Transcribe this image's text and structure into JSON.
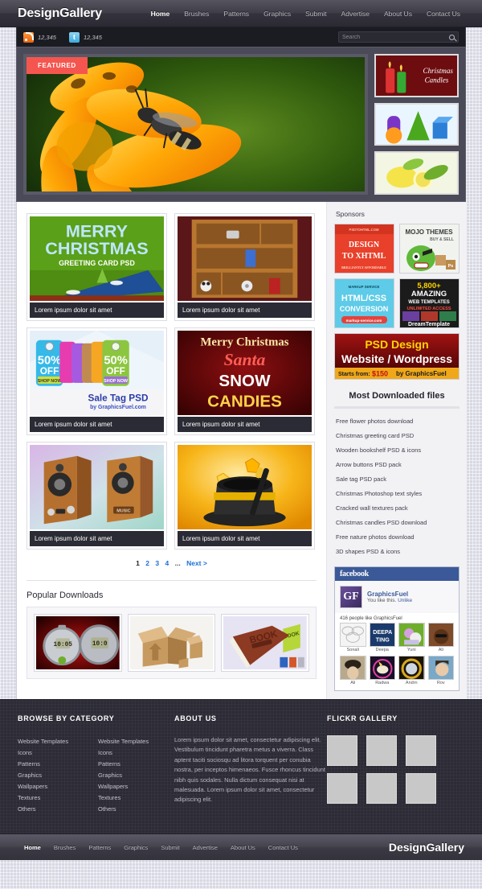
{
  "site": {
    "brand": "DesignGallery",
    "footer_brand": "DesignGallery"
  },
  "topnav": {
    "items": [
      {
        "label": "Home",
        "active": true
      },
      {
        "label": "Brushes",
        "active": false
      },
      {
        "label": "Patterns",
        "active": false
      },
      {
        "label": "Graphics",
        "active": false
      },
      {
        "label": "Submit",
        "active": false
      },
      {
        "label": "Advertise",
        "active": false
      },
      {
        "label": "About Us",
        "active": false
      },
      {
        "label": "Contact Us",
        "active": false
      }
    ]
  },
  "utilbar": {
    "rss_icon": "rss-icon",
    "rss_count": "12,345",
    "twitter_icon": "twitter-icon",
    "twitter_count": "12,345",
    "search_placeholder": "Search",
    "search_value": "",
    "search_icon": "magnifier-icon"
  },
  "slider": {
    "badge": "FEATURED",
    "main_alt": "bee-on-orange-flower",
    "thumbs": [
      {
        "alt": "christmas-candles",
        "caption": "Christmas Candles"
      },
      {
        "alt": "3d-shapes"
      },
      {
        "alt": "lemons"
      }
    ]
  },
  "gallery": {
    "cards": [
      {
        "alt": "merry-christmas-greeting-card",
        "title_line1": "MERRY",
        "title_line2": "CHRISTMAS",
        "subtitle": "GREETING CARD PSD",
        "caption": "Lorem ipsum dolor sit amet"
      },
      {
        "alt": "wooden-bookshelf",
        "caption": "Lorem ipsum dolor sit amet"
      },
      {
        "alt": "sale-tag-psd",
        "label": "50%",
        "label2": "OFF",
        "button": "SHOP NOW",
        "title": "Sale Tag PSD",
        "byline": "by GraphicsFuel.com",
        "caption": "Lorem ipsum dolor sit amet"
      },
      {
        "alt": "santa-snow-candies",
        "line1": "Merry Christmas",
        "line2": "Santa",
        "line3": "SNOW",
        "line4": "CANDIES",
        "caption": "Lorem ipsum dolor sit amet"
      },
      {
        "alt": "wooden-speakers",
        "badge": "MUSIC",
        "caption": "Lorem ipsum dolor sit amet"
      },
      {
        "alt": "magic-hat-and-wand",
        "caption": "Lorem ipsum dolor sit amet"
      }
    ],
    "pagination": {
      "pages": [
        "1",
        "2",
        "3",
        "4"
      ],
      "current": "1",
      "ellipsis": "...",
      "next": "Next >"
    }
  },
  "popular": {
    "heading": "Popular Downloads",
    "items": [
      {
        "alt": "stopwatch-icons",
        "display": "10:05"
      },
      {
        "alt": "cardboard-box-icons"
      },
      {
        "alt": "book-icons",
        "display": "BOOK"
      }
    ]
  },
  "sidebar": {
    "sponsors_title": "Sponsors",
    "ads": [
      {
        "name": "design-to-xhtml-ad",
        "top": "PSDTOHTML.COM",
        "line1": "DESIGN",
        "line2": "TO XHTML",
        "foot": "BRILLIANTLY AFFORDABLE"
      },
      {
        "name": "mojo-themes-ad",
        "line1": "MOJO THEMES",
        "line2": "BUY & SELL"
      },
      {
        "name": "markup-service-ad",
        "top": "MARKUP SERVICE",
        "line1": "HTML/CSS",
        "line2": "CONVERSION",
        "foot": "markup-service.com"
      },
      {
        "name": "dreamtemplate-ad",
        "line1": "5,800+",
        "line2": "AMAZING",
        "line3": "WEB TEMPLATES",
        "line4": "UNLIMITED ACCESS",
        "foot": "DreamTemplate"
      }
    ],
    "wide_ad": {
      "name": "psd-design-ad",
      "line1": "PSD Design",
      "line2": "Website / Wordpress",
      "foot_left": "Starts from:",
      "foot_price": "$150",
      "foot_right": "by GraphicsFuel"
    },
    "most_downloaded_title": "Most Downloaded files",
    "most_downloaded": [
      "Free flower photos download",
      "Christmas greeting card PSD",
      "Wooden bookshelf PSD & icons",
      "Arrow buttons PSD pack",
      "Sale tag PSD pack",
      "Christmas Photoshop text styles",
      "Cracked wall textures pack",
      "Christmas candles PSD download",
      "Free nature photos download",
      "3D shapes PSD & icons"
    ],
    "facebook": {
      "bar_title": "facebook",
      "avatar_text": "GF",
      "page_name": "GraphicsFuel",
      "like_status": "You like this.",
      "unlike": "Unlike",
      "count_text": "416 people like GraphicsFuel",
      "fans": [
        {
          "name": "Sonali"
        },
        {
          "name": "Deepa"
        },
        {
          "name": "Yuni"
        },
        {
          "name": "Ali"
        },
        {
          "name": "Ali"
        },
        {
          "name": "Radwa"
        },
        {
          "name": "Andrn"
        },
        {
          "name": "Rov"
        }
      ]
    }
  },
  "footer": {
    "category_title": "BROWSE BY CATEGORY",
    "category_col1": [
      "Website Templates",
      "Icons",
      "Patterns",
      "Graphics",
      "Wallpapers",
      "Textures",
      "Others"
    ],
    "category_col2": [
      "Website Templates",
      "Icons",
      "Patterns",
      "Graphics",
      "Wallpapers",
      "Textures",
      "Others"
    ],
    "about_title": "ABOUT US",
    "about_text": "Lorem ipsum dolor sit amet, consectetur adipiscing elit. Vestibulum tincidunt pharetra metus a viverra. Class aptent taciti sociosqu ad litora torquent per conubia nostra, per inceptos himenaeos. Fusce rhoncus tincidunt nibh quis sodales. Nulla dictum consequat nisi at malesuada. Lorem ipsum dolor sit amet, consectetur adipiscing elit.",
    "flickr_title": "FLICKR GALLERY",
    "flickr_count": 6
  },
  "bottomnav": {
    "items": [
      {
        "label": "Home",
        "active": true
      },
      {
        "label": "Brushes",
        "active": false
      },
      {
        "label": "Patterns",
        "active": false
      },
      {
        "label": "Graphics",
        "active": false
      },
      {
        "label": "Submit",
        "active": false
      },
      {
        "label": "Advertise",
        "active": false
      },
      {
        "label": "About Us",
        "active": false
      },
      {
        "label": "Contact Us",
        "active": false
      }
    ]
  },
  "colors": {
    "accent_red": "#f4564f",
    "link_blue": "#1d6fd6",
    "facebook_blue": "#3b5998",
    "header_dark": "#3e3d48",
    "footer_dark": "#2c2b36"
  }
}
